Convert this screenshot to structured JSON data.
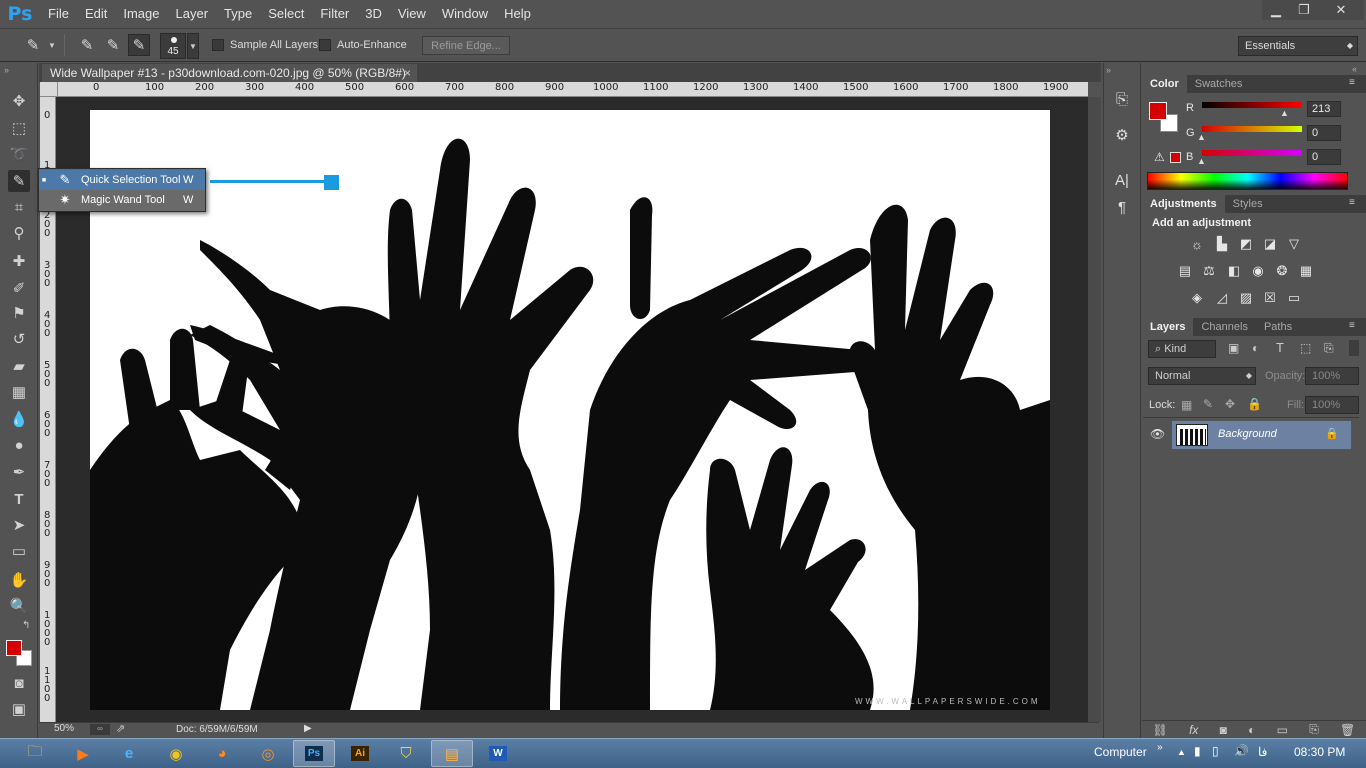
{
  "app": {
    "logo": "Ps",
    "window_buttons": {
      "minimize": "▁",
      "restore": "❐",
      "close": "✕"
    }
  },
  "menu": [
    "File",
    "Edit",
    "Image",
    "Layer",
    "Type",
    "Select",
    "Filter",
    "3D",
    "View",
    "Window",
    "Help"
  ],
  "options": {
    "brush_size": "45",
    "sample_all_layers": "Sample All Layers",
    "auto_enhance": "Auto-Enhance",
    "refine_edge": "Refine Edge...",
    "workspace": "Essentials"
  },
  "document": {
    "tab_title": "Wide Wallpaper #13 - p30download.com-020.jpg @ 50% (RGB/8#)",
    "tab_close": "×",
    "ruler_h": [
      "0",
      "100",
      "200",
      "300",
      "400",
      "500",
      "600",
      "700",
      "800",
      "900",
      "1000",
      "1100",
      "1200",
      "1300",
      "1400",
      "1500",
      "1600",
      "1700",
      "1800",
      "1900"
    ],
    "ruler_v": [
      "0",
      "1 0 0",
      "2 0 0",
      "3 0 0",
      "4 0 0",
      "5 0 0",
      "6 0 0",
      "7 0 0",
      "8 0 0",
      "9 0 0",
      "1 0 0 0",
      "1 1 0 0"
    ],
    "watermark": "WWW.WALLPAPERSWIDE.COM"
  },
  "status": {
    "zoom": "50%",
    "doc": "Doc: 6/59M/6/59M"
  },
  "flyout": {
    "items": [
      {
        "label": "Quick Selection Tool",
        "shortcut": "W"
      },
      {
        "label": "Magic Wand Tool",
        "shortcut": "W"
      }
    ]
  },
  "color_panel": {
    "tabs": [
      "Color",
      "Swatches"
    ],
    "r_label": "R",
    "g_label": "G",
    "b_label": "B",
    "r": "213",
    "g": "0",
    "b": "0",
    "foreground": "#d50000"
  },
  "adjustments_panel": {
    "tabs": [
      "Adjustments",
      "Styles"
    ],
    "heading": "Add an adjustment"
  },
  "layers_panel": {
    "tabs": [
      "Layers",
      "Channels",
      "Paths"
    ],
    "kind": "Kind",
    "blend": "Normal",
    "opacity_label": "Opacity:",
    "opacity": "100%",
    "lock_label": "Lock:",
    "fill_label": "Fill:",
    "fill": "100%",
    "layer_name": "Background"
  },
  "taskbar": {
    "computer": "Computer",
    "time": "08:30 PM",
    "lang": "فا"
  }
}
